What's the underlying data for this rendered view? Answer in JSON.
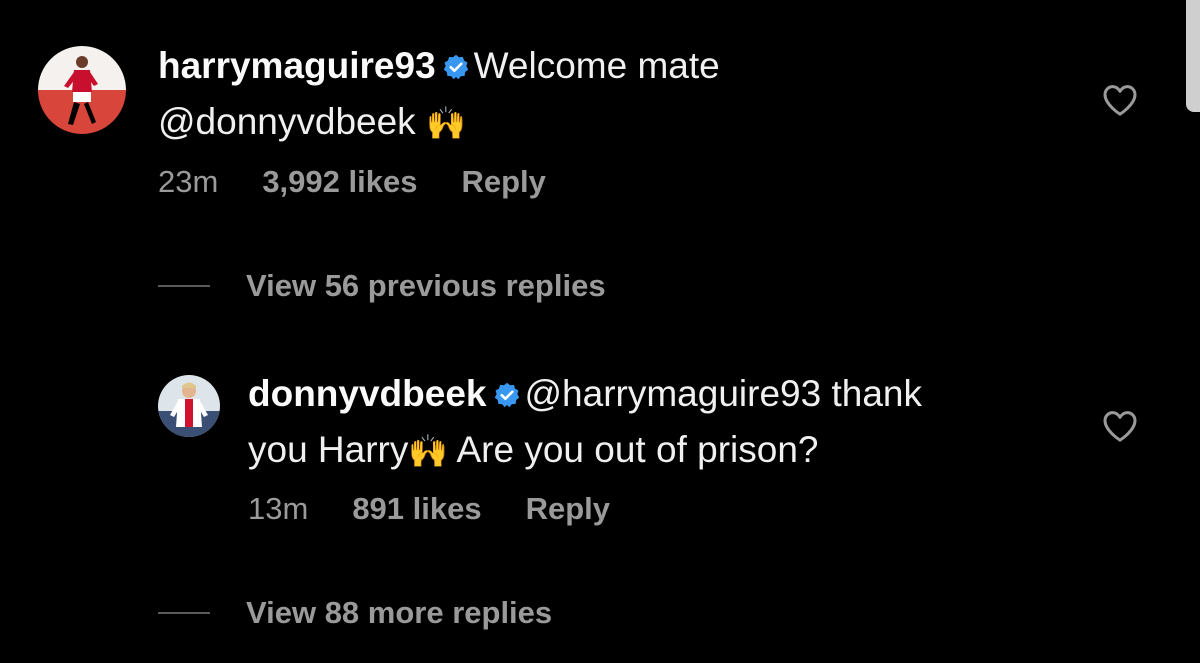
{
  "comments": [
    {
      "username": "harrymaguire93",
      "text_line1": "Welcome mate",
      "text_line2": "@donnyvdbeek",
      "emoji": "🙌",
      "time": "23m",
      "likes": "3,992 likes",
      "reply_label": "Reply"
    },
    {
      "username": "donnyvdbeek",
      "text_line1": "@harrymaguire93 thank",
      "text_line2a": "you Harry",
      "emoji": "🙌",
      "text_line2b": "Are you out of prison?",
      "time": "13m",
      "likes": "891 likes",
      "reply_label": "Reply"
    }
  ],
  "view_previous_replies": "View 56 previous replies",
  "view_more_replies": "View 88 more replies",
  "colors": {
    "background": "#000000",
    "text": "#f0f0f0",
    "muted": "#9a9a9a",
    "verified": "#3897f0",
    "emoji": "#f5b800"
  },
  "icons": [
    "verified-badge-icon",
    "heart-outline-icon"
  ]
}
